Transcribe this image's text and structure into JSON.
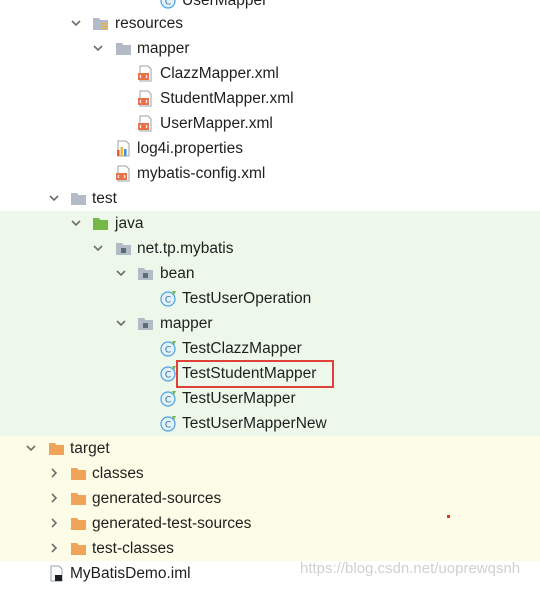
{
  "tree": {
    "top_partial": "UserMapper",
    "resources": "resources",
    "mapper_dir": "mapper",
    "clazz_xml": "ClazzMapper.xml",
    "student_xml": "StudentMapper.xml",
    "user_xml": "UserMapper.xml",
    "log4j": "log4i.properties",
    "mybatis_config": "mybatis-config.xml",
    "test": "test",
    "java": "java",
    "package": "net.tp.mybatis",
    "bean": "bean",
    "test_user_operation": "TestUserOperation",
    "test_mapper_dir": "mapper",
    "test_clazz": "TestClazzMapper",
    "test_student": "TestStudentMapper",
    "test_user": "TestUserMapper",
    "test_user_new": "TestUserMapperNew",
    "target": "target",
    "classes": "classes",
    "generated_sources": "generated-sources",
    "generated_test_sources": "generated-test-sources",
    "test_classes": "test-classes",
    "iml": "MyBatisDemo.iml"
  },
  "watermark": "https://blog.csdn.net/uoprewqsnh",
  "colors": {
    "test_bg": "#eef8ea",
    "target_bg": "#fdfde7",
    "highlight": "#e0403a"
  }
}
